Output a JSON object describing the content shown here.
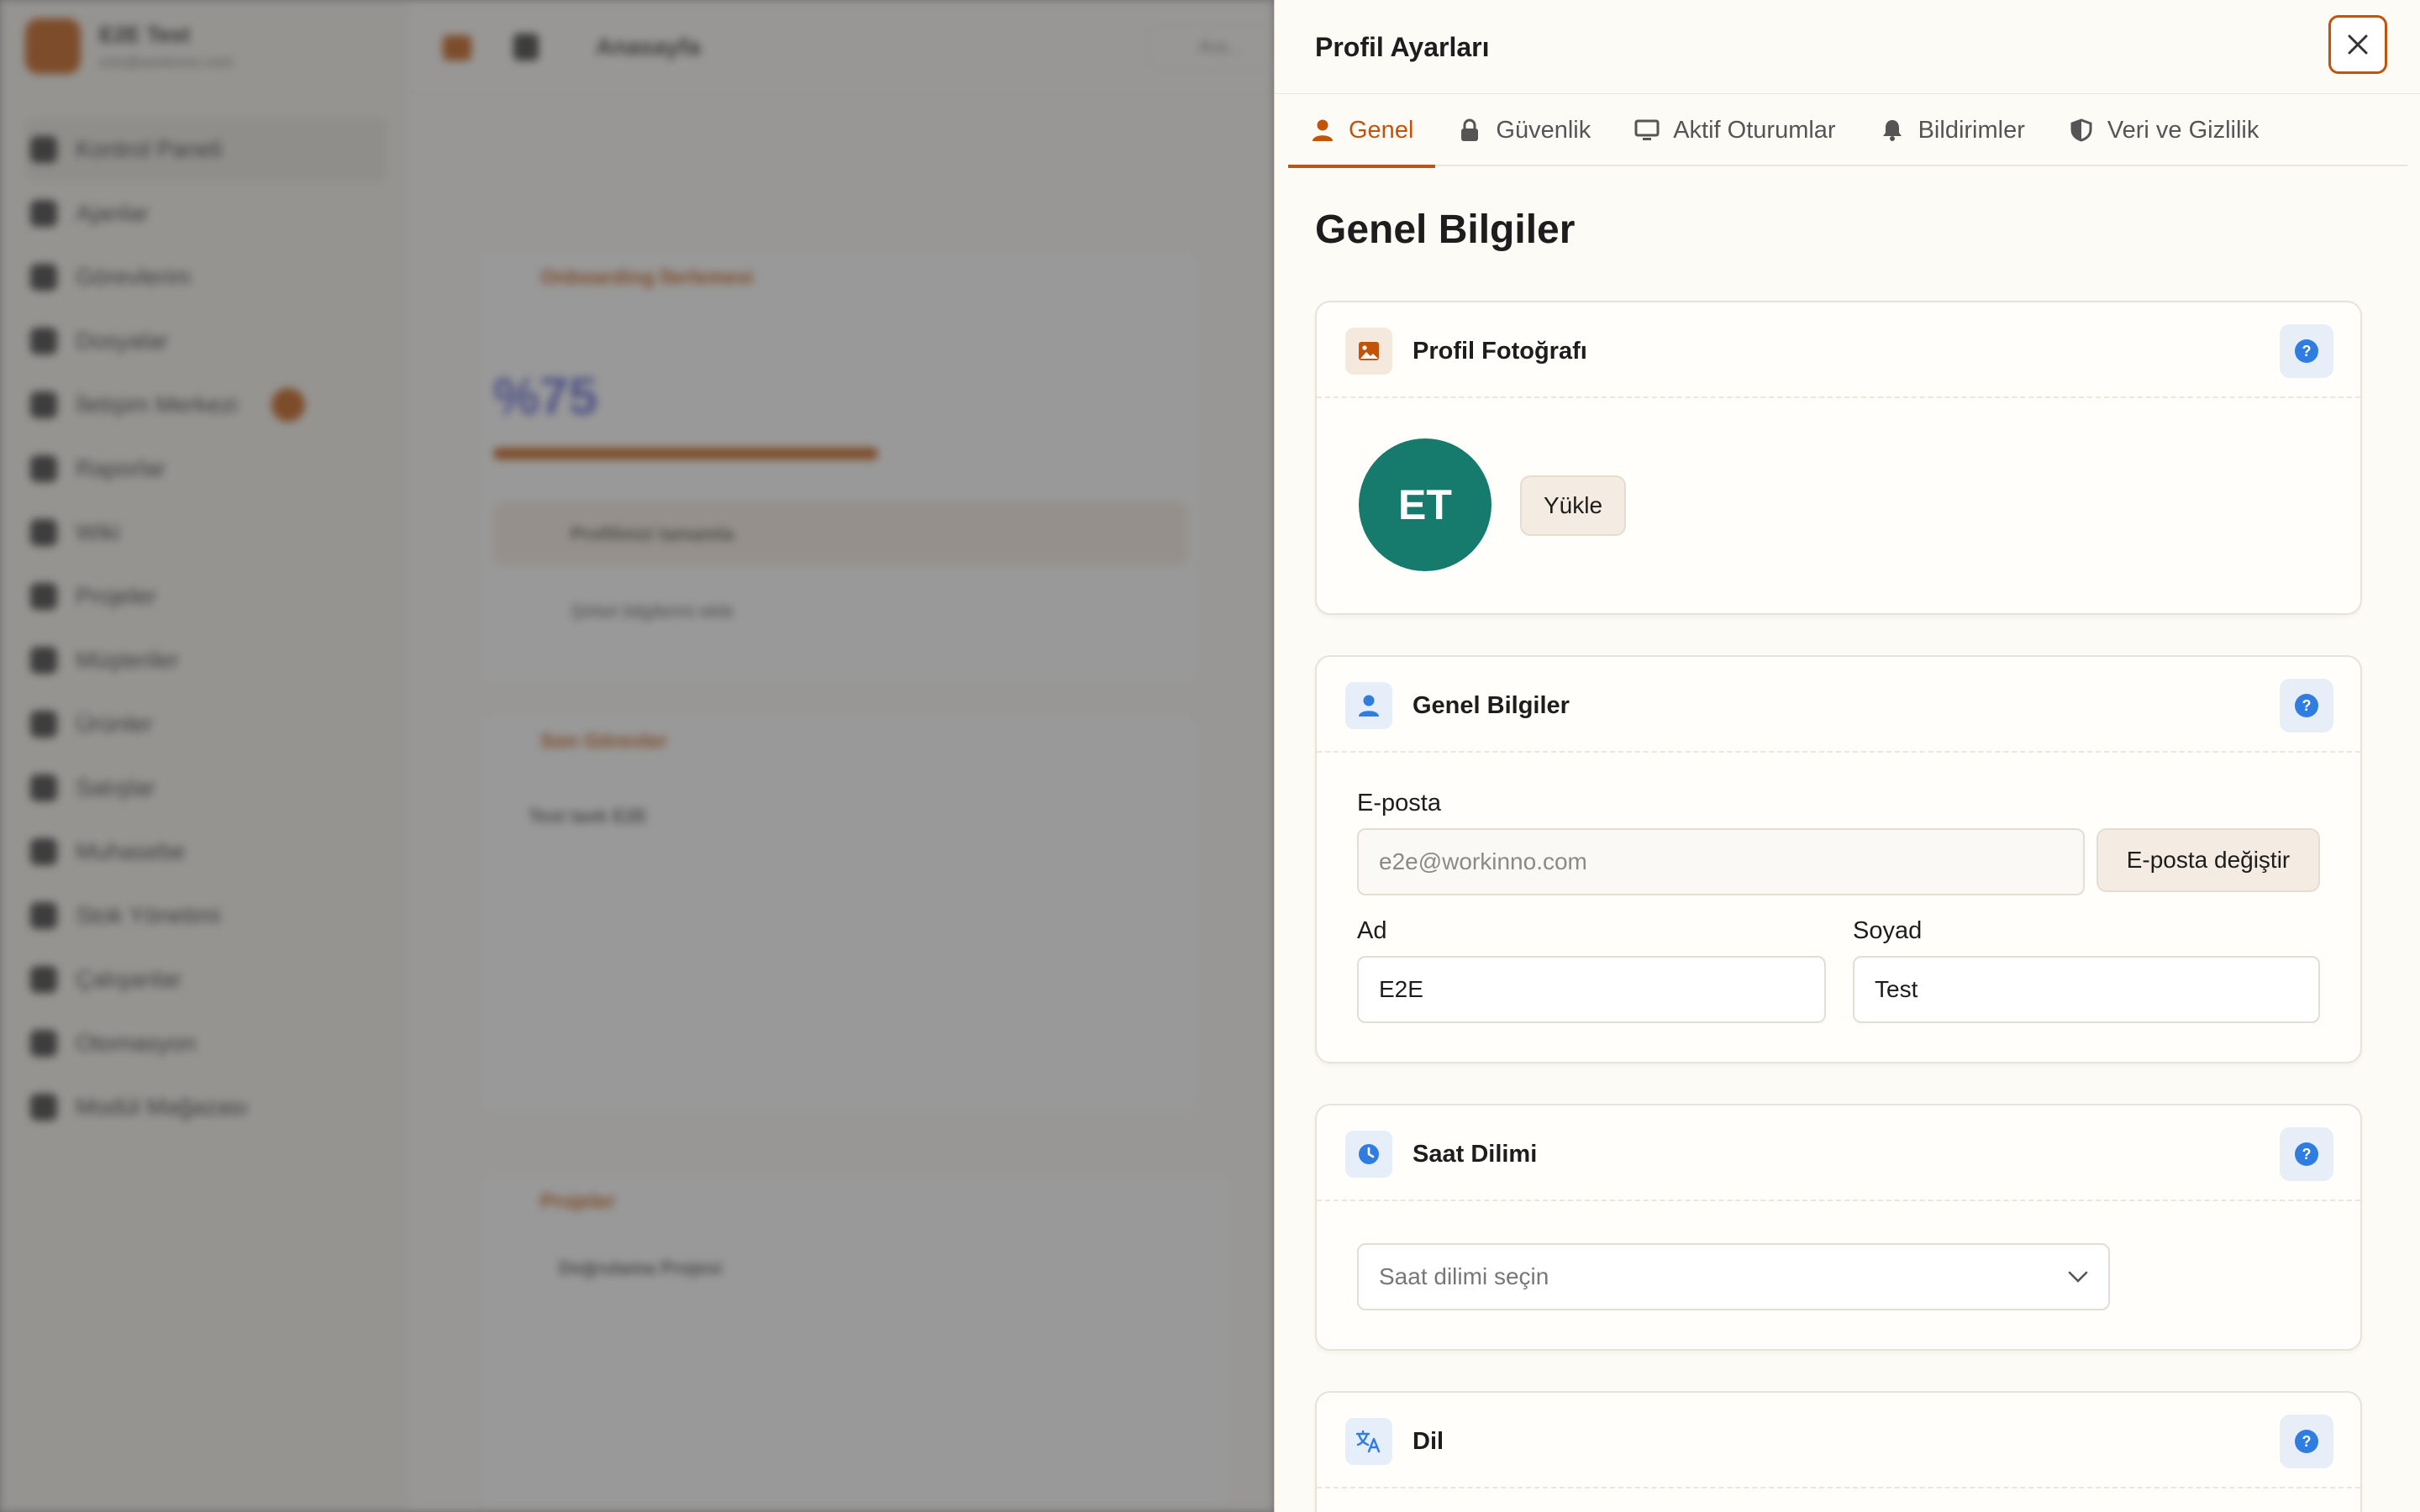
{
  "background": {
    "app_name": "E2E Test",
    "app_subtitle": "e2e@workinno.com",
    "breadcrumb": "Anasayfa",
    "search_placeholder": "Ara...",
    "nav_items": [
      "Kontrol Paneli",
      "Ajanlar",
      "Görevlerim",
      "Dosyalar",
      "İletişim Merkezi",
      "Raporlar",
      "Wiki",
      "Projeler",
      "Müşteriler",
      "Ürünler",
      "Satışlar",
      "Muhasebe",
      "Stok Yönetimi",
      "Çalışanlar",
      "Otomasyon",
      "Modül Mağazası"
    ],
    "card1_title": "Onboarding İlerlemesi",
    "card1_percent": "%75",
    "card1_progress": 0.75,
    "card1_row1": "Profilinizi tamamla",
    "card1_row2": "Şirket bilgilerini ekle",
    "card2_title": "Son Görevler",
    "card2_task": "Test task E2E",
    "card3_title": "Projeler",
    "card3_project": "Doğrulama Projesi"
  },
  "panel": {
    "title": "Profil Ayarları",
    "close_label": "×",
    "tabs": [
      {
        "label": "Genel",
        "icon": "user-icon"
      },
      {
        "label": "Güvenlik",
        "icon": "lock-icon"
      },
      {
        "label": "Aktif Oturumlar",
        "icon": "monitor-icon"
      },
      {
        "label": "Bildirimler",
        "icon": "bell-icon"
      },
      {
        "label": "Veri ve Gizlilik",
        "icon": "shield-icon"
      }
    ],
    "section_title": "Genel Bilgiler",
    "photo_card": {
      "title": "Profil Fotoğrafı",
      "avatar_initials": "ET",
      "upload_label": "Yükle",
      "avatar_color": "#167a6d"
    },
    "info_card": {
      "title": "Genel Bilgiler",
      "email_label": "E-posta",
      "email_value": "e2e@workinno.com",
      "change_email_label": "E-posta değiştir",
      "first_name_label": "Ad",
      "first_name_value": "E2E",
      "last_name_label": "Soyad",
      "last_name_value": "Test"
    },
    "timezone_card": {
      "title": "Saat Dilimi",
      "select_placeholder": "Saat dilimi seçin"
    },
    "language_card": {
      "title": "Dil"
    },
    "help_label": "?",
    "accent_color": "#c2540a",
    "help_color": "#2f7de1"
  }
}
